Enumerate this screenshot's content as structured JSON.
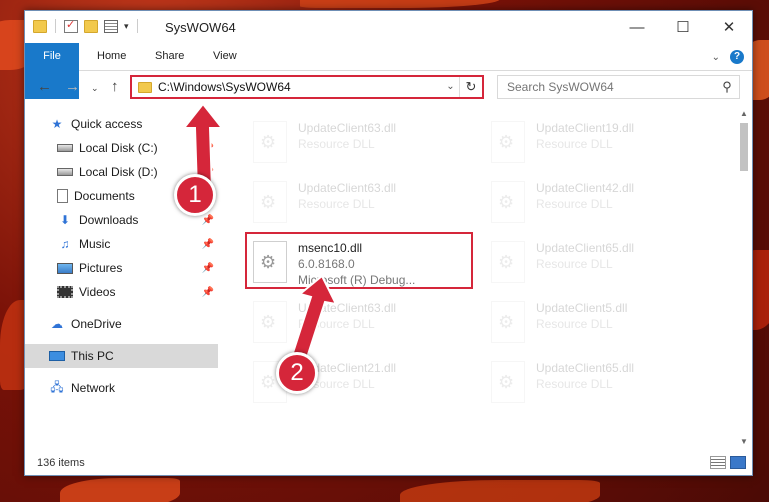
{
  "window": {
    "title": "SysWOW64"
  },
  "ribbon": {
    "tabs": [
      "File",
      "Home",
      "Share",
      "View"
    ],
    "help_label": "?"
  },
  "nav": {
    "address": "C:\\Windows\\SysWOW64",
    "search_placeholder": "Search SysWOW64"
  },
  "sidebar": {
    "items": [
      {
        "label": "Quick access",
        "icon": "star-icon"
      },
      {
        "label": "Local Disk (C:)",
        "icon": "drive-icon",
        "pinned": true
      },
      {
        "label": "Local Disk (D:)",
        "icon": "drive-icon",
        "pinned": true
      },
      {
        "label": "Documents",
        "icon": "documents-icon",
        "pinned": true
      },
      {
        "label": "Downloads",
        "icon": "download-icon",
        "pinned": true
      },
      {
        "label": "Music",
        "icon": "music-icon",
        "pinned": true
      },
      {
        "label": "Pictures",
        "icon": "pictures-icon",
        "pinned": true
      },
      {
        "label": "Videos",
        "icon": "videos-icon",
        "pinned": true
      },
      {
        "label": "OneDrive",
        "icon": "cloud-icon"
      },
      {
        "label": "This PC",
        "icon": "computer-icon",
        "selected": true
      },
      {
        "label": "Network",
        "icon": "network-icon"
      }
    ]
  },
  "files": {
    "left": [
      {
        "name": "UpdateClient63.dll",
        "sub": "Resource DLL"
      },
      {
        "name": "UpdateClient63.dll",
        "sub": "Resource DLL"
      },
      {
        "name": "msenc10.dll",
        "sub": "6.0.8168.0",
        "sub2": "Microsoft (R) Debug...",
        "highlighted": true
      },
      {
        "name": "UpdateClient63.dll",
        "sub": "Resource DLL"
      },
      {
        "name": "UpdateClient21.dll",
        "sub": "Resource DLL"
      }
    ],
    "right": [
      {
        "name": "UpdateClient19.dll",
        "sub": "Resource DLL"
      },
      {
        "name": "UpdateClient42.dll",
        "sub": "Resource DLL"
      },
      {
        "name": "UpdateClient65.dll",
        "sub": "Resource DLL"
      },
      {
        "name": "UpdateClient5.dll",
        "sub": "Resource DLL"
      },
      {
        "name": "UpdateClient65.dll",
        "sub": "Resource DLL"
      }
    ]
  },
  "status": {
    "count": "136 items"
  },
  "annotations": {
    "step1": "1",
    "step2": "2"
  },
  "colors": {
    "accent": "#1979ca",
    "highlight": "#d5263a"
  }
}
